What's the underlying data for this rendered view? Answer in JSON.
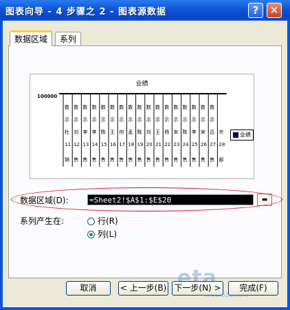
{
  "window": {
    "title": "图表向导 - 4 步骤之 2 - 图表源数据"
  },
  "titlebar_buttons": {
    "help": "?",
    "close": "✕"
  },
  "tabs": [
    {
      "label": "数据区域",
      "active": true
    },
    {
      "label": "系列",
      "active": false
    }
  ],
  "preview": {
    "title": "业绩",
    "legend": "业绩",
    "left_label": "100000",
    "category_rows": [
      [
        "数",
        "数",
        "数",
        "数",
        "数",
        "数",
        "数",
        "数",
        "数",
        "数",
        "数",
        "数",
        "数",
        "数",
        "数",
        "数",
        "数"
      ],
      [
        "示",
        "示",
        "示",
        "示",
        "示",
        "示",
        "示",
        "示",
        "示",
        "示",
        "示",
        "示",
        "示",
        "示",
        "示",
        "示",
        "示"
      ],
      [
        "杜",
        "刘",
        "李",
        "李",
        "陈",
        "王",
        "何",
        "孟",
        "陈",
        "刘",
        "王",
        "杨",
        "宋",
        "陈",
        "李",
        "宋",
        "吕",
        "许"
      ],
      [
        "11",
        "12",
        "13",
        "14",
        "15",
        "16",
        "17",
        "18",
        "19",
        "20",
        "21",
        "22",
        "23",
        "24",
        "25",
        "26",
        "27",
        "28"
      ],
      [
        "销",
        "售",
        "售",
        "售",
        "售",
        "售",
        "售",
        "售",
        "售",
        "售",
        "售",
        "售",
        "售",
        "售",
        "售",
        "售",
        "售",
        "部"
      ]
    ]
  },
  "data_range": {
    "label": "数据区域(D):",
    "value": "=Sheet2!$A$1:$E$20"
  },
  "series_in": {
    "label": "系列产生在:",
    "options": [
      {
        "label": "行(R)",
        "checked": false
      },
      {
        "label": "列(L)",
        "checked": true
      }
    ]
  },
  "buttons": {
    "cancel": "取消",
    "back": "< 上一步(B)",
    "next": "下一步(N) >",
    "finish": "完成(F)"
  },
  "watermark": {
    "text": "eta",
    "sub": "www.52d.com"
  },
  "colors": {
    "titlebar": "#0a55d8",
    "selection": "#000000",
    "annotation": "#d81818"
  }
}
